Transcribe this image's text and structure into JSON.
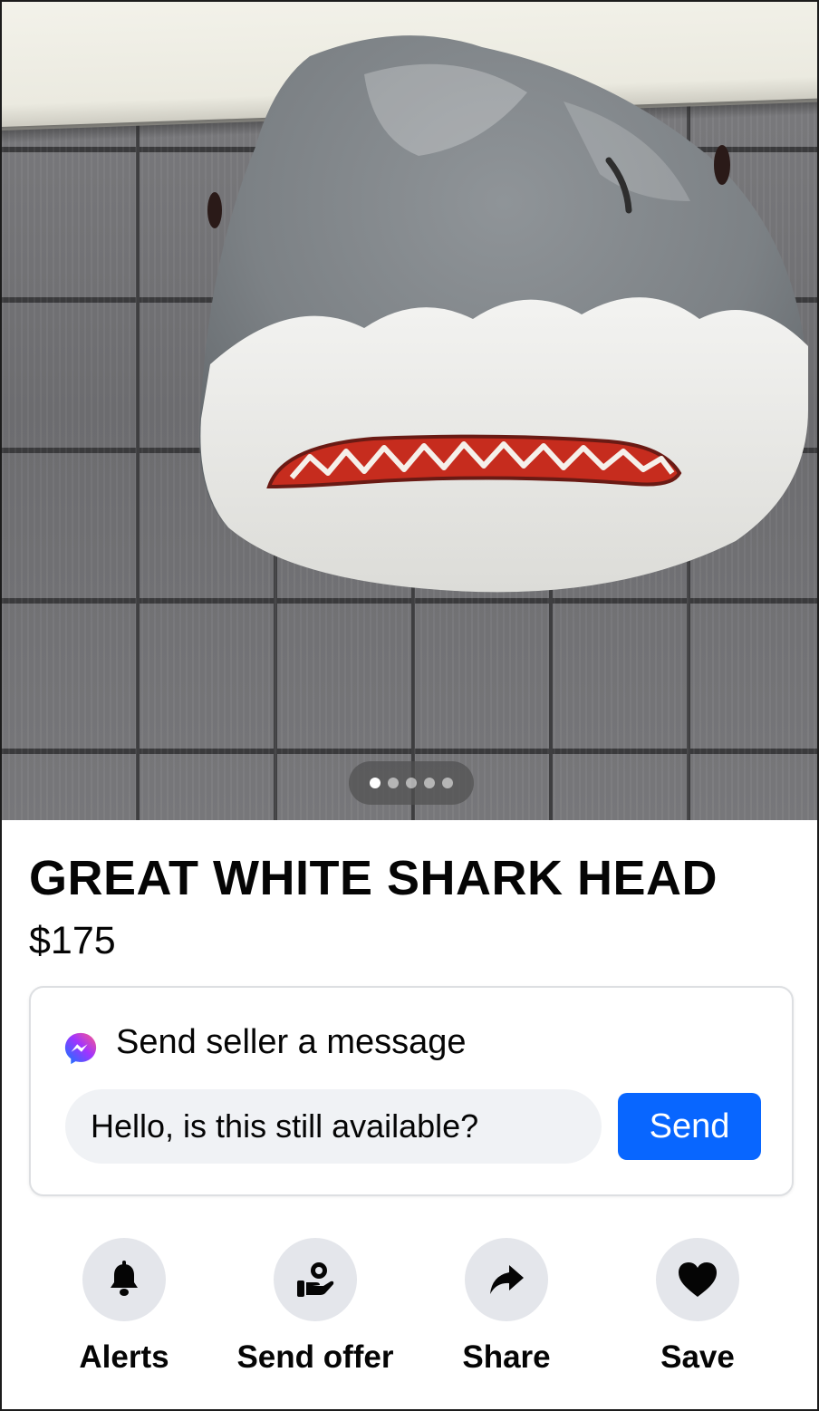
{
  "listing": {
    "title": "GREAT WHITE SHARK HEAD",
    "price": "$175",
    "photo": {
      "current_index": 1,
      "total": 5
    }
  },
  "message_box": {
    "header": "Send seller a message",
    "header_icon": "messenger-icon",
    "input_value": "Hello, is this still available?",
    "send_label": "Send",
    "send_color": "#0866ff"
  },
  "actions": [
    {
      "label": "Alerts",
      "icon": "bell-icon"
    },
    {
      "label": "Send offer",
      "icon": "offer-icon"
    },
    {
      "label": "Share",
      "icon": "share-icon"
    },
    {
      "label": "Save",
      "icon": "heart-icon"
    }
  ]
}
